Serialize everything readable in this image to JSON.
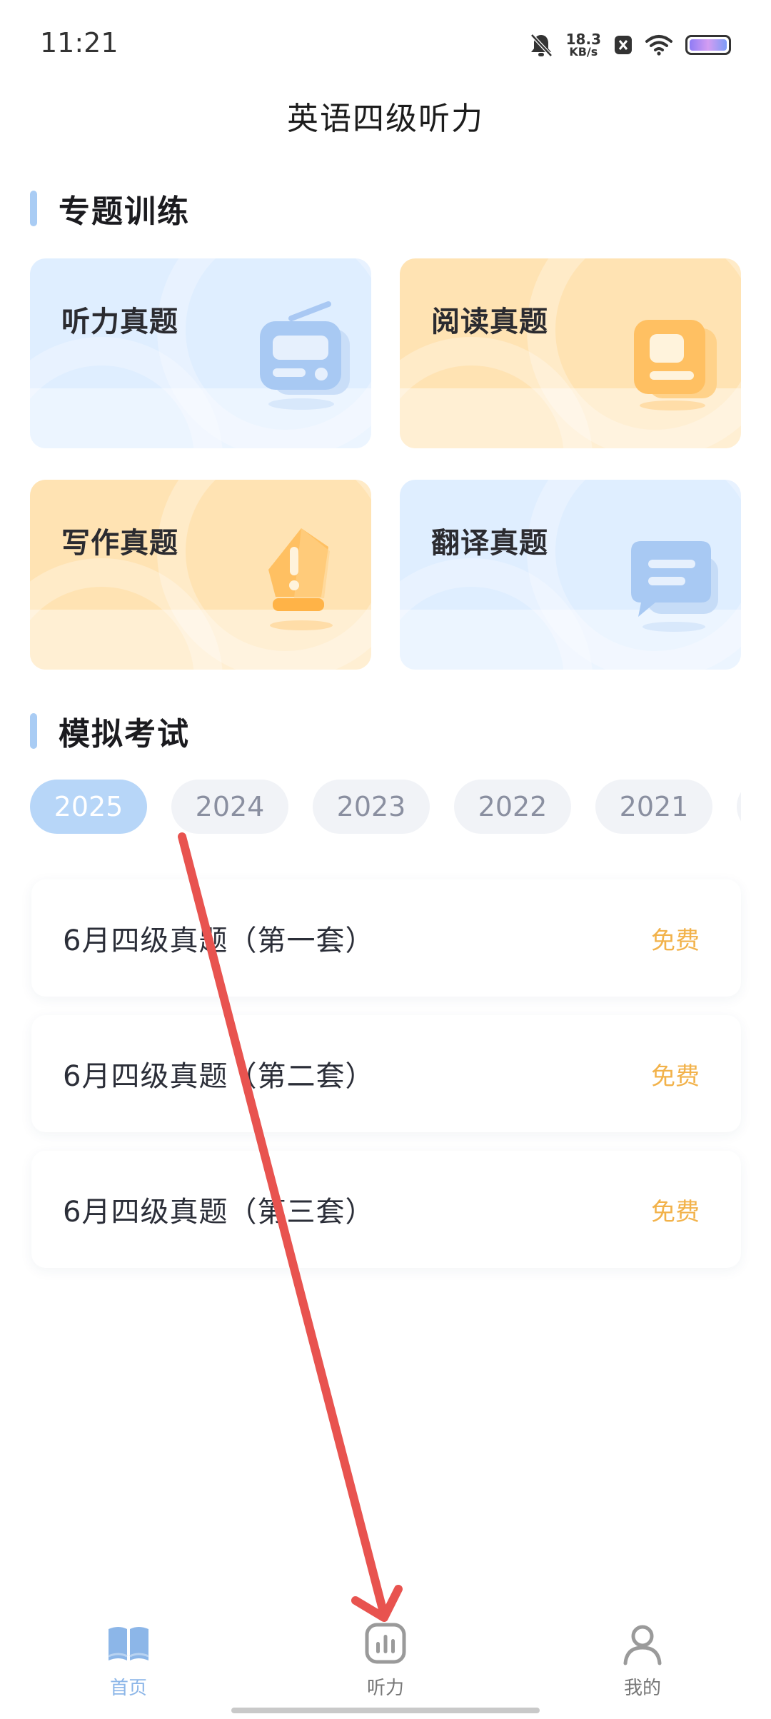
{
  "status_bar": {
    "time": "11:21",
    "net_speed_value": "18.3",
    "net_speed_unit": "KB/s",
    "icons": [
      "bell-mute-icon",
      "close-box-icon",
      "wifi-icon",
      "battery-icon"
    ]
  },
  "header": {
    "title": "英语四级听力"
  },
  "topics": {
    "heading": "专题训练",
    "cards": [
      {
        "label": "听力真题",
        "theme": "blue",
        "icon": "radio-icon"
      },
      {
        "label": "阅读真题",
        "theme": "orange",
        "icon": "book-icon"
      },
      {
        "label": "写作真题",
        "theme": "orange",
        "icon": "pen-nib-icon"
      },
      {
        "label": "翻译真题",
        "theme": "blue",
        "icon": "chat-bubble-icon"
      }
    ]
  },
  "mock_exams": {
    "heading": "模拟考试",
    "years": [
      "2025",
      "2024",
      "2023",
      "2022",
      "2021"
    ],
    "selected_year": "2025",
    "items": [
      {
        "title": "6月四级真题（第一套）",
        "badge": "免费"
      },
      {
        "title": "6月四级真题（第二套）",
        "badge": "免费"
      },
      {
        "title": "6月四级真题（第三套）",
        "badge": "免费"
      }
    ]
  },
  "bottom_nav": {
    "items": [
      {
        "label": "首页",
        "icon": "book-open-icon",
        "active": true
      },
      {
        "label": "听力",
        "icon": "bar-chart-icon",
        "active": false
      },
      {
        "label": "我的",
        "icon": "user-icon",
        "active": false
      }
    ]
  },
  "colors": {
    "accent_blue": "#8cb6e8",
    "badge_orange": "#f2b24a",
    "annotation_red": "#e8534f"
  }
}
